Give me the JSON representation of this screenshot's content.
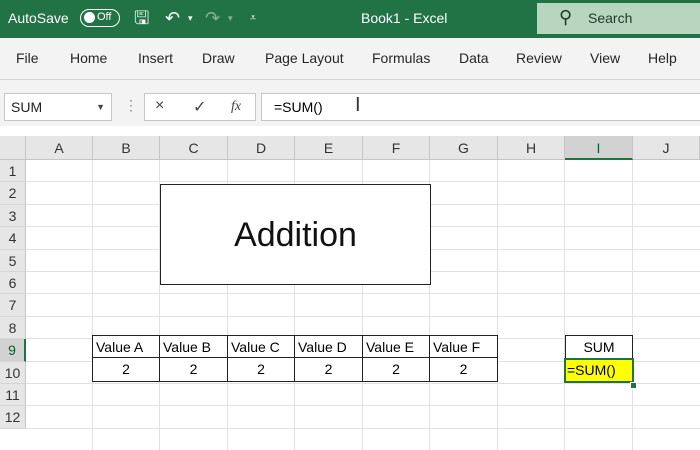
{
  "titlebar": {
    "autosave_label": "AutoSave",
    "autosave_state": "Off",
    "doc_title": "Book1 - Excel",
    "search_label": "Search",
    "icons": [
      "save-icon",
      "undo-icon",
      "redo-icon",
      "customize-qat-icon",
      "search-icon"
    ],
    "bg_color": "#217346"
  },
  "ribbon": {
    "tabs": [
      "File",
      "Home",
      "Insert",
      "Draw",
      "Page Layout",
      "Formulas",
      "Data",
      "Review",
      "View",
      "Help"
    ]
  },
  "formula_bar": {
    "name_box": "SUM",
    "cancel_icon": "×",
    "enter_icon": "✓",
    "fx_label": "fx",
    "formula": "=SUM()"
  },
  "grid": {
    "columns": [
      "A",
      "B",
      "C",
      "D",
      "E",
      "F",
      "G",
      "H",
      "I",
      "J"
    ],
    "rows": [
      "1",
      "2",
      "3",
      "4",
      "5",
      "6",
      "7",
      "8",
      "9",
      "10",
      "11",
      "12"
    ],
    "selected_column": "I",
    "selected_row": "9"
  },
  "sheet": {
    "title_box": "Addition",
    "headers": [
      "Value A",
      "Value B",
      "Value C",
      "Value D",
      "Value E",
      "Value F"
    ],
    "values": [
      "2",
      "2",
      "2",
      "2",
      "2",
      "2"
    ],
    "sum_header": "SUM",
    "active_cell_text": "=SUM()",
    "active_cell_color": "#ffff00"
  }
}
